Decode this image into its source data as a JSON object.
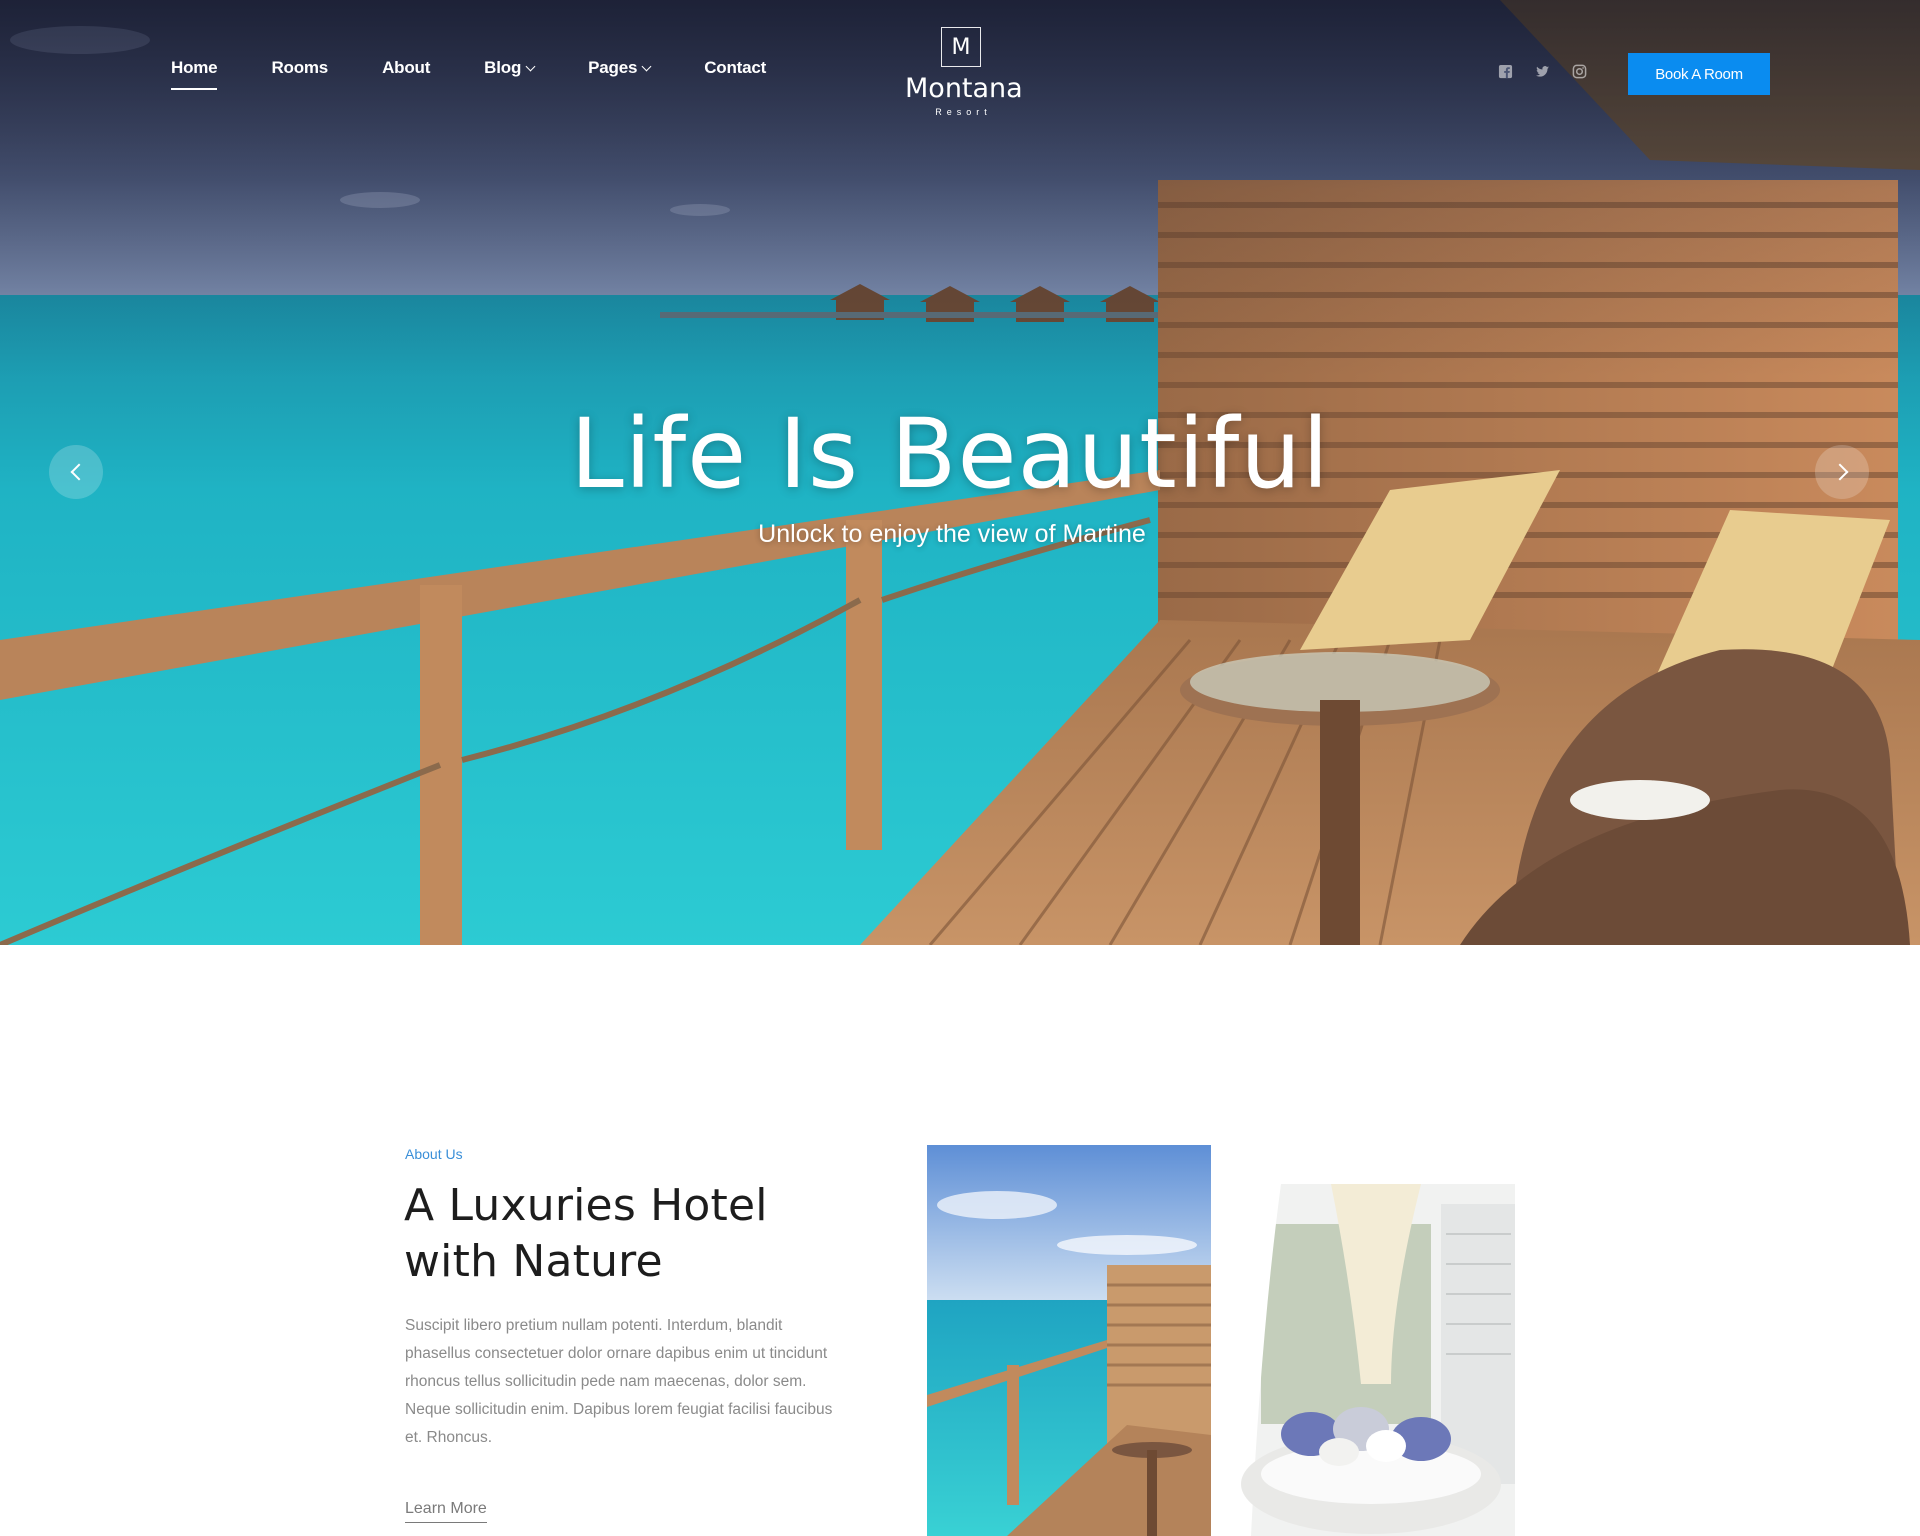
{
  "header": {
    "nav": [
      {
        "label": "Home",
        "active": true
      },
      {
        "label": "Rooms"
      },
      {
        "label": "About"
      },
      {
        "label": "Blog",
        "dropdown": true
      },
      {
        "label": "Pages",
        "dropdown": true
      },
      {
        "label": "Contact"
      }
    ],
    "logo": {
      "letter": "M",
      "name": "Montana",
      "sub": "Resort"
    },
    "social": [
      "facebook-icon",
      "twitter-icon",
      "instagram-icon"
    ],
    "book_label": "Book A Room",
    "accent": "#0a8cf0"
  },
  "hero": {
    "title": "Life Is Beautiful",
    "subtitle": "Unlock to enjoy the view of Martine"
  },
  "about": {
    "eyebrow": "About Us",
    "title": "A Luxuries Hotel with Nature",
    "body": "Suscipit libero pretium nullam potenti. Interdum, blandit phasellus consectetuer dolor ornare dapibus enim ut tincidunt rhoncus tellus sollicitudin pede nam maecenas, dolor sem. Neque sollicitudin enim. Dapibus lorem feugiat facilisi faucibus et. Rhoncus.",
    "link": "Learn More"
  }
}
